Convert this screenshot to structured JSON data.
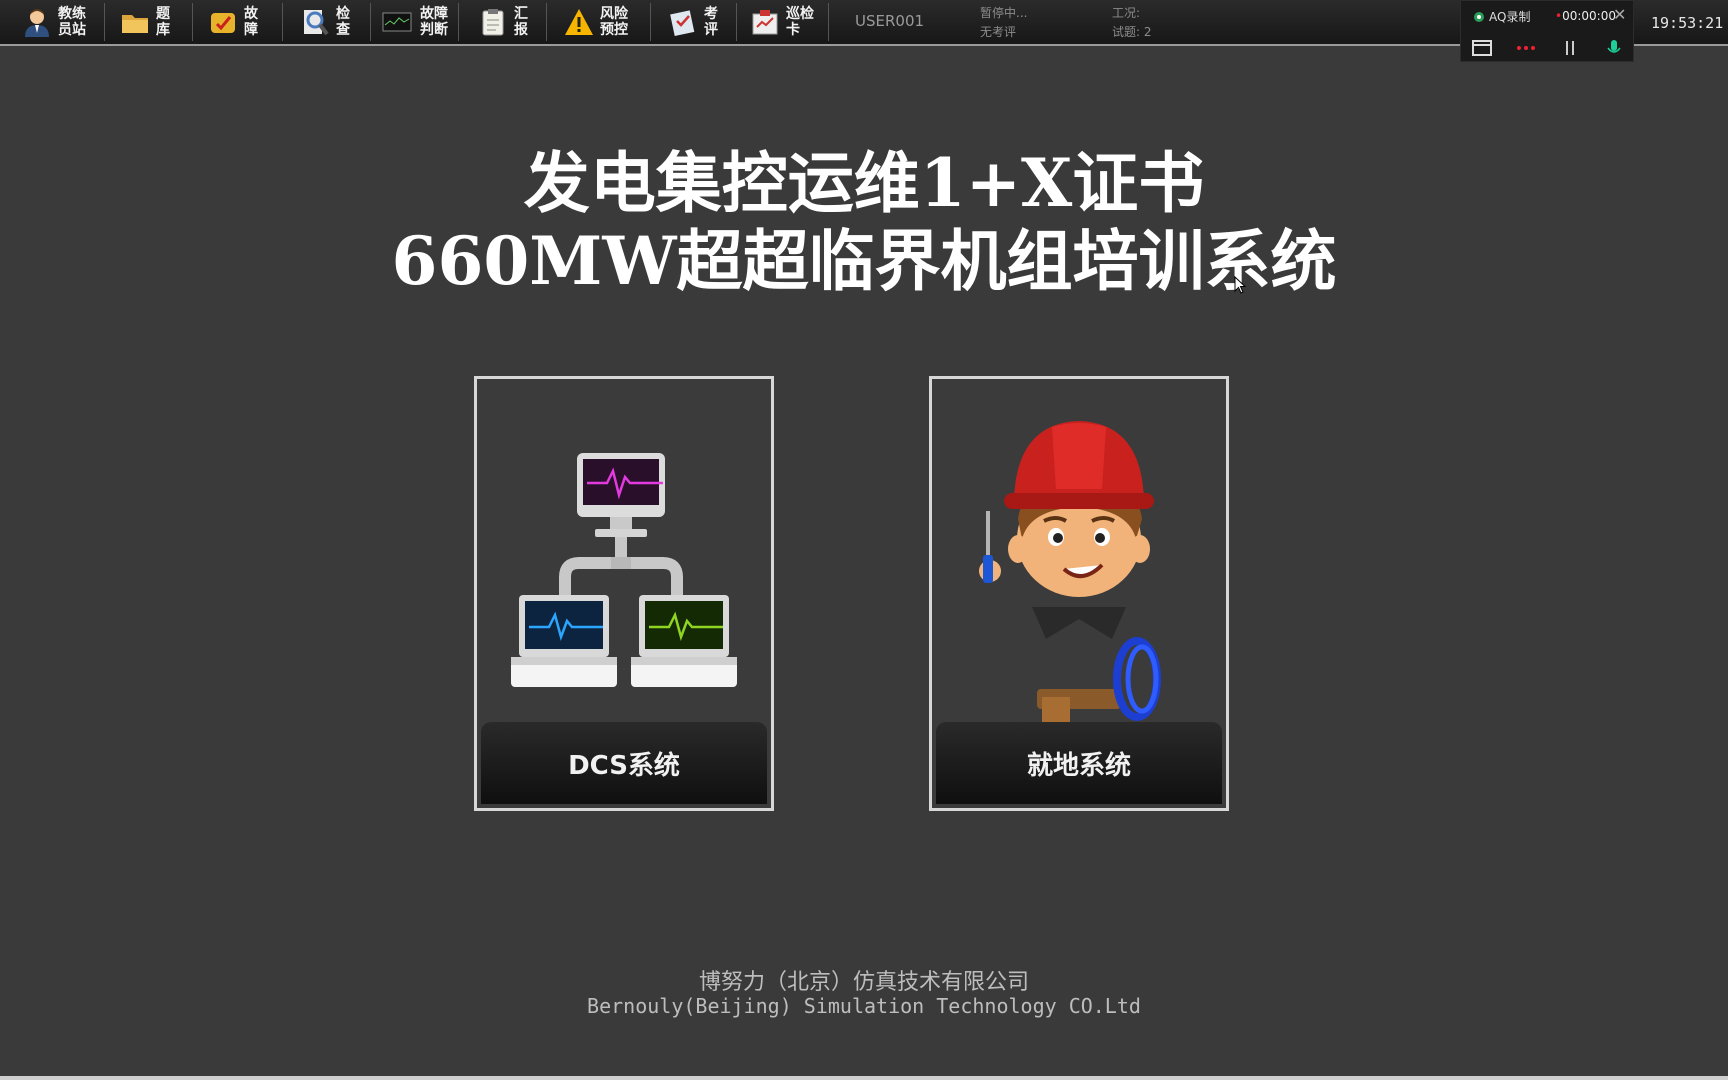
{
  "toolbar": {
    "buttons": [
      {
        "label": "教练\n员站",
        "icon": "trainer-station-icon"
      },
      {
        "label": "题\n库",
        "icon": "folder-icon"
      },
      {
        "label": "故\n障",
        "icon": "fault-icon"
      },
      {
        "label": "检\n查",
        "icon": "magnifier-icon"
      },
      {
        "label": "故障\n判断",
        "icon": "monitor-icon"
      },
      {
        "label": "汇\n报",
        "icon": "clipboard-icon"
      },
      {
        "label": "风险\n预控",
        "icon": "warning-icon"
      },
      {
        "label": "考\n评",
        "icon": "exam-icon"
      },
      {
        "label": "巡检\n卡",
        "icon": "inspection-card-icon"
      }
    ],
    "user_id": "USER001",
    "status": "暂停中...\n无考评",
    "condition": "工况:\n试题: 2"
  },
  "recorder": {
    "title": "AQ录制",
    "time": "00:00:00",
    "close": "✕"
  },
  "clock": "19:53:21",
  "title": {
    "line1": "发电集控运维1+X证书",
    "line2": "660MW超超临界机组培训系统"
  },
  "cards": {
    "dcs": {
      "label": "DCS系统"
    },
    "local": {
      "label": "就地系统"
    }
  },
  "company": {
    "cn": "博努力（北京）仿真技术有限公司",
    "en": "Bernouly(Beijing) Simulation Technology CO.Ltd"
  },
  "colors": {
    "background": "#3a3a3a",
    "helmet": "#c8211e",
    "accent_magenta": "#e23adf",
    "accent_blue": "#2aa6ff",
    "accent_green": "#8fd420"
  }
}
